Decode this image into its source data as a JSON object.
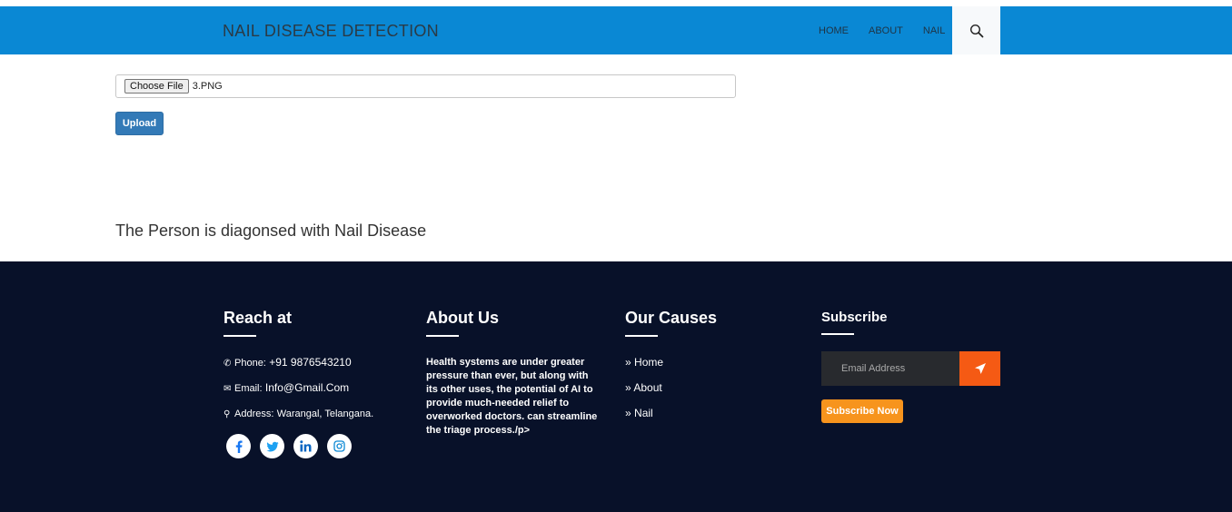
{
  "navbar": {
    "brand": "NAIL DISEASE DETECTION",
    "links": [
      "HOME",
      "ABOUT",
      "NAIL"
    ],
    "search_icon": "search-icon",
    "bg_color": "#0a88d4"
  },
  "upload": {
    "choose_label": "Choose File",
    "file_name": "3.PNG",
    "upload_label": "Upload"
  },
  "result": {
    "text": "The Person is diagonsed with Nail Disease"
  },
  "footer": {
    "reach": {
      "title": "Reach at",
      "phone_label": "Phone:",
      "phone_value": "+91 9876543210",
      "email_label": "Email:",
      "email_value": "Info@Gmail.Com",
      "address_label": "Address:",
      "address_value": "Warangal, Telangana.",
      "social_icons": [
        "facebook-icon",
        "twitter-icon",
        "linkedin-icon",
        "instagram-icon"
      ]
    },
    "about": {
      "title": "About Us",
      "text": "Health systems are under greater pressure than ever, but along with its other uses, the potential of AI to provide much-needed relief to overworked doctors. can streamline the triage process./p>"
    },
    "causes": {
      "title": "Our Causes",
      "items": [
        "Home",
        "About",
        "Nail"
      ]
    },
    "subscribe": {
      "title": "Subscribe",
      "email_placeholder": "Email Address",
      "button_label": "Subscribe Now",
      "accent_color": "#f55a14"
    },
    "bg_color": "#081129"
  }
}
